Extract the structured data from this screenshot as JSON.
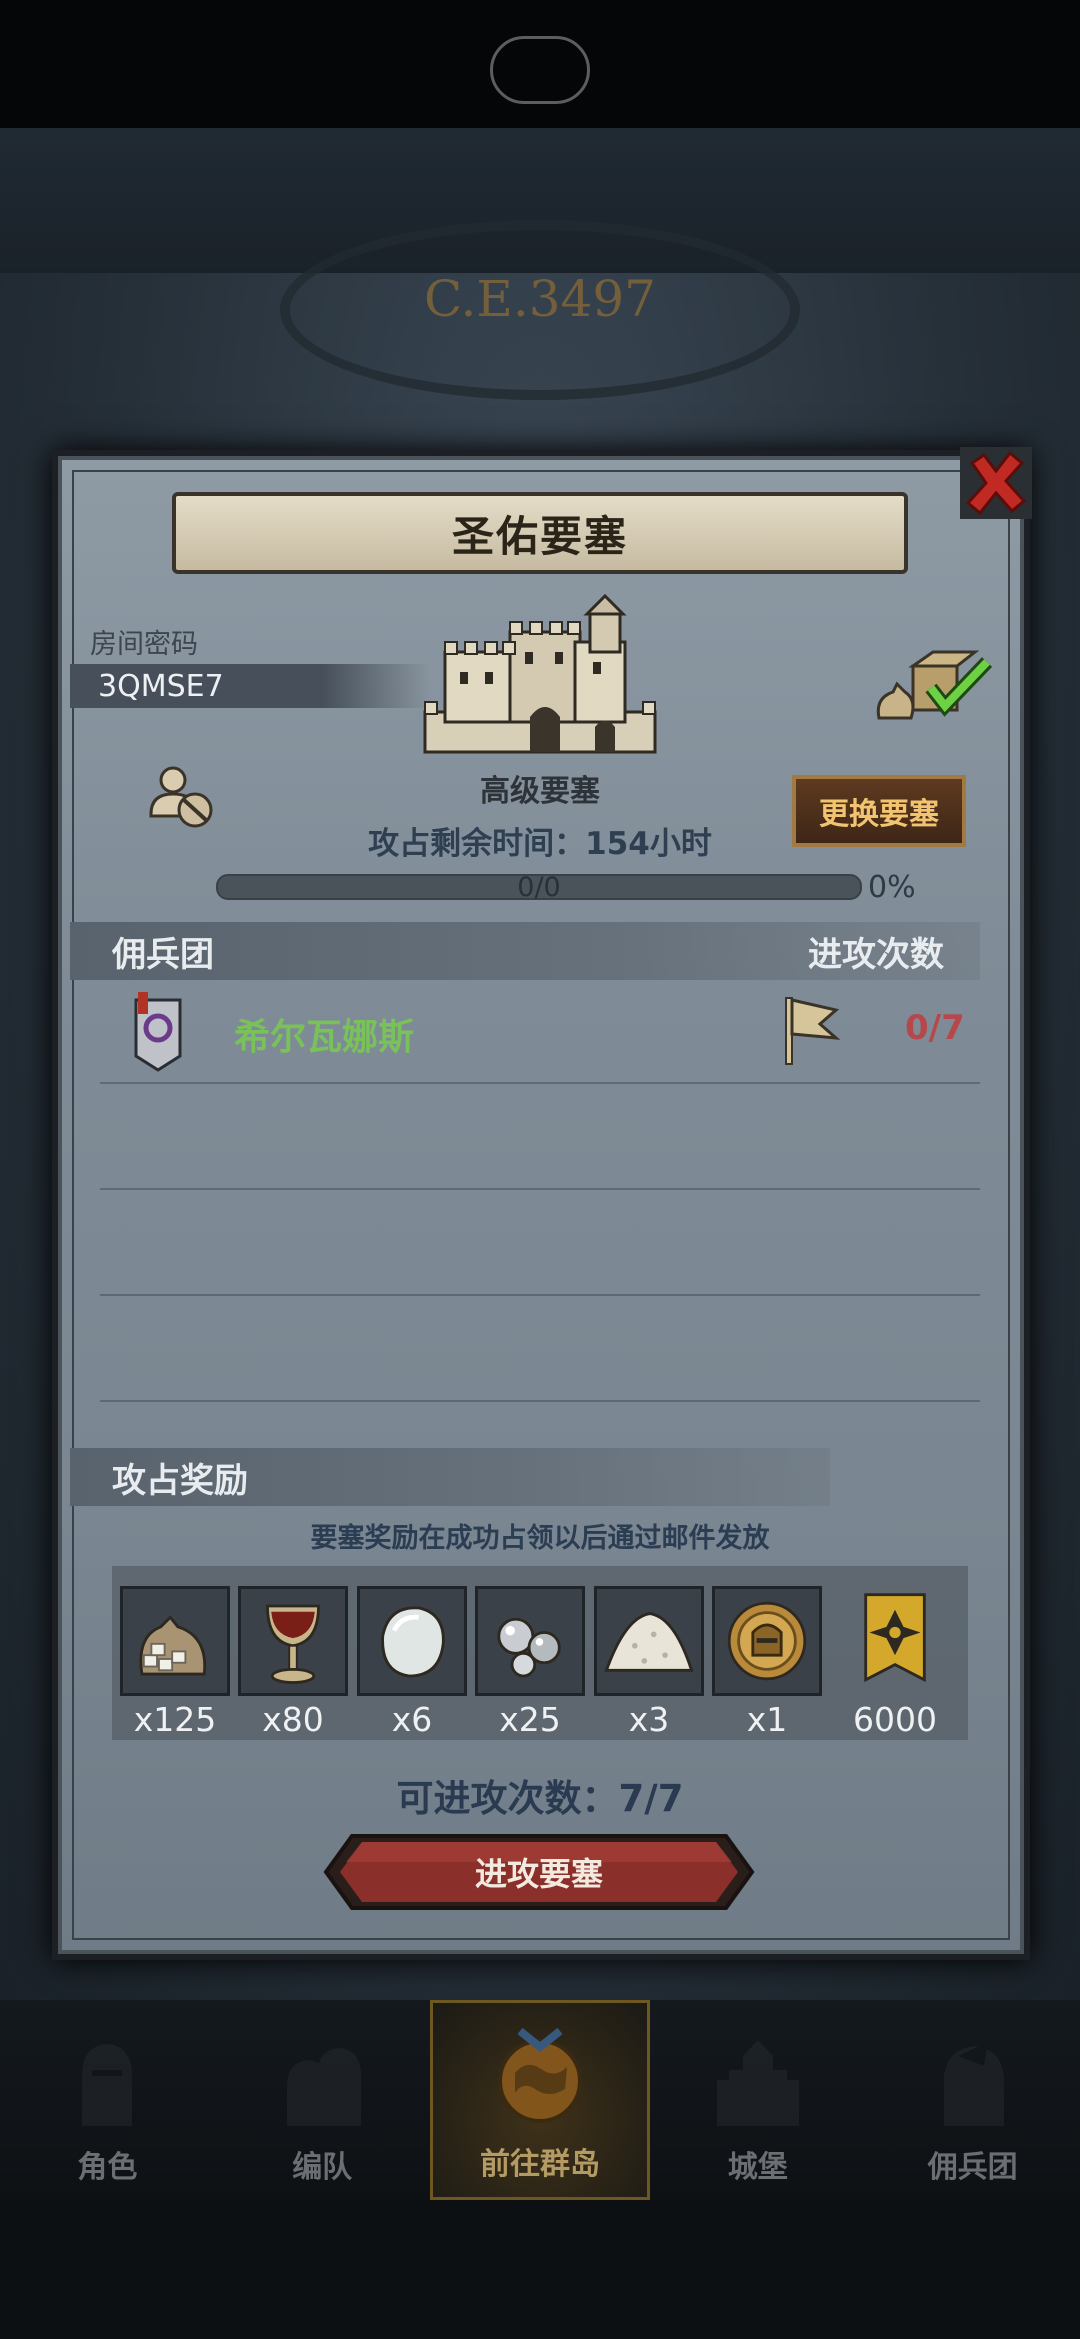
{
  "background": {
    "era_text": "C.E.3497"
  },
  "modal": {
    "title": "圣佑要塞",
    "room": {
      "label": "房间密码",
      "code": "3QMSE7"
    },
    "fortress": {
      "type": "高级要塞",
      "change_button": "更换要塞",
      "timer_text": "攻占剩余时间：154小时",
      "progress_text": "0/0",
      "progress_percent": "0%",
      "progress_fraction": 0
    },
    "mercenary_section": {
      "left_header": "佣兵团",
      "right_header": "进攻次数",
      "rows": [
        {
          "name": "希尔瓦娜斯",
          "attacks": "0/7"
        }
      ]
    },
    "rewards_section": {
      "header": "攻占奖励",
      "note": "要塞奖励在成功占领以后通过邮件发放",
      "items": [
        {
          "icon": "sugar-sack-icon",
          "count": "x125"
        },
        {
          "icon": "wine-goblet-icon",
          "count": "x80"
        },
        {
          "icon": "white-stone-icon",
          "count": "x6"
        },
        {
          "icon": "silver-ore-icon",
          "count": "x25"
        },
        {
          "icon": "salt-pile-icon",
          "count": "x3"
        },
        {
          "icon": "knight-medal-icon",
          "count": "x1"
        },
        {
          "icon": "rank-badge-icon",
          "count": "6000"
        }
      ]
    },
    "attacks_left": "可进攻次数：7/7",
    "attack_button": "进攻要塞"
  },
  "bottom_nav": {
    "items": [
      {
        "label": "角色",
        "icon": "knight-icon"
      },
      {
        "label": "编队",
        "icon": "formation-icon"
      },
      {
        "label": "前往群岛",
        "icon": "island-globe-icon"
      },
      {
        "label": "城堡",
        "icon": "castle-icon"
      },
      {
        "label": "佣兵团",
        "icon": "mercenary-icon"
      }
    ],
    "active_index": 2
  },
  "colors": {
    "mercenary_name": "#79c25a",
    "attack_count": "#b6474b",
    "change_button_text": "#f2c470",
    "attack_button": "#8a2f2a"
  }
}
